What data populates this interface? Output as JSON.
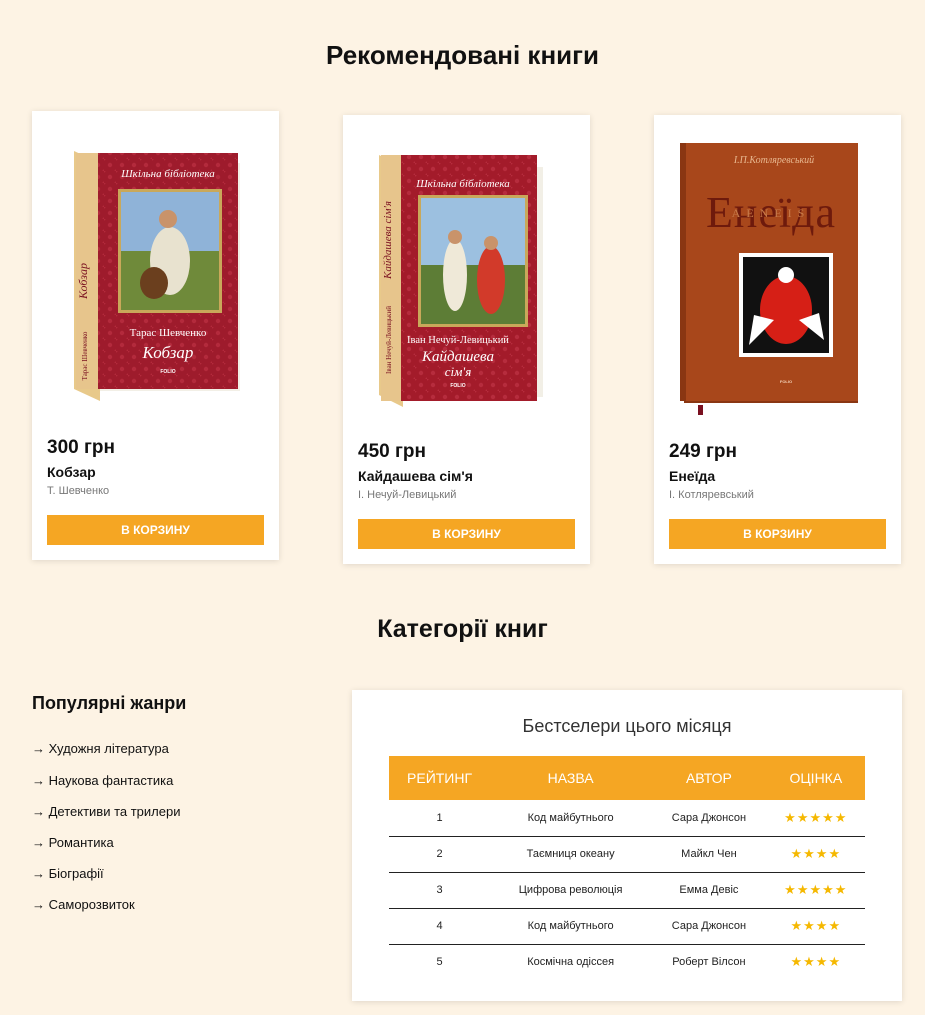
{
  "recommended": {
    "title": "Рекомендовані книги",
    "books": [
      {
        "price": "300 грн",
        "title": "Кобзар",
        "author": "Т. Шевченко",
        "button": "В КОРЗИНУ",
        "cover": {
          "series": "Шкільна бібліотека",
          "author": "Тарас Шевченко",
          "title": "Кобзар",
          "publisher": "FOLIO",
          "spine": "Кобзар",
          "spine_author": "Тарас Шевченко"
        }
      },
      {
        "price": "450 грн",
        "title": "Кайдашева сім'я",
        "author": "І. Нечуй-Левицький",
        "button": "В КОРЗИНУ",
        "cover": {
          "series": "Шкільна бібліотека",
          "author": "Іван Нечуй-Левицький",
          "title_line1": "Кайдашева",
          "title_line2": "сім'я",
          "publisher": "FOLIO",
          "spine": "Кайдашева сім'я",
          "spine_author": "Іван Нечуй-Левицький"
        }
      },
      {
        "price": "249 грн",
        "title": "Енеїда",
        "author": "І. Котляревський",
        "button": "В КОРЗИНУ",
        "cover": {
          "author": "І.П.Котляревський",
          "title": "Енеїда",
          "overlay": "AENEIS",
          "publisher": "FOLIO"
        }
      }
    ]
  },
  "categories": {
    "title": "Категорії книг",
    "genres_title": "Популярні жанри",
    "genres": [
      "→ Художня література",
      "→ Наукова фантастика",
      "→ Детективи та трилери",
      "→ Романтика",
      "→ Біографії",
      "→ Саморозвиток"
    ]
  },
  "bestsellers": {
    "caption": "Бестселери цього місяця",
    "headers": [
      "РЕЙТИНГ",
      "НАЗВА",
      "АВТОР",
      "ОЦІНКА"
    ],
    "rows": [
      {
        "rank": "1",
        "title": "Код майбутнього",
        "author": "Сара Джонсон",
        "stars": 5
      },
      {
        "rank": "2",
        "title": "Таємниця океану",
        "author": "Майкл Чен",
        "stars": 4
      },
      {
        "rank": "3",
        "title": "Цифрова революція",
        "author": "Емма Девіс",
        "stars": 5
      },
      {
        "rank": "4",
        "title": "Код майбутнього",
        "author": "Сара Джонсон",
        "stars": 4
      },
      {
        "rank": "5",
        "title": "Космічна одіссея",
        "author": "Роберт Вілсон",
        "stars": 4
      }
    ]
  },
  "colors": {
    "accent": "#f5a623",
    "background": "#fdf3e4",
    "star": "#f5b800"
  }
}
